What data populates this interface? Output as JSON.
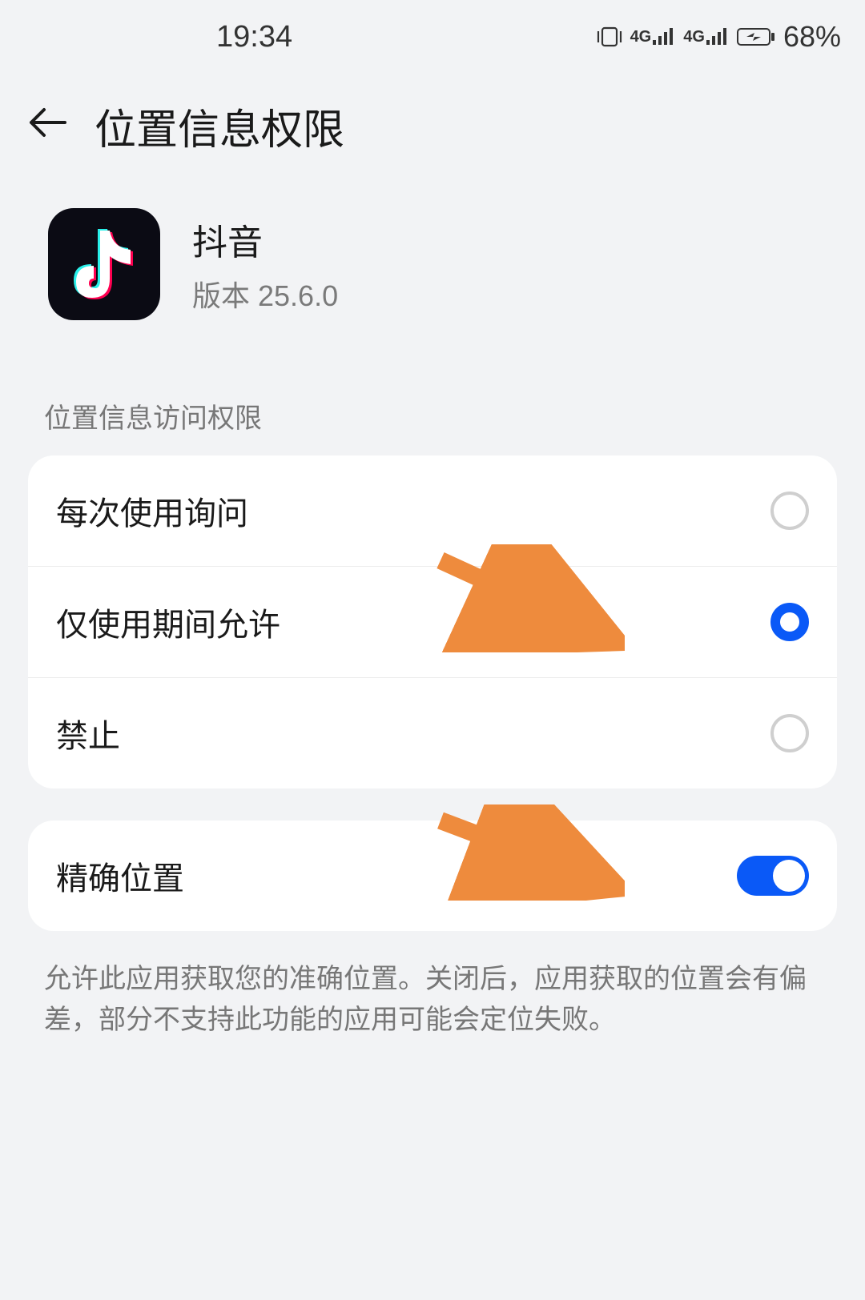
{
  "status_bar": {
    "time": "19:34",
    "network1": "4G",
    "network2": "4G",
    "battery_percent": "68%"
  },
  "header": {
    "title": "位置信息权限"
  },
  "app": {
    "name": "抖音",
    "version": "版本 25.6.0"
  },
  "section_label": "位置信息访问权限",
  "options": {
    "ask_every_time": "每次使用询问",
    "allow_while_using": "仅使用期间允许",
    "deny": "禁止",
    "selected_index": 1
  },
  "precise_location": {
    "label": "精确位置",
    "enabled": true
  },
  "description": "允许此应用获取您的准确位置。关闭后，应用获取的位置会有偏差，部分不支持此功能的应用可能会定位失败。"
}
